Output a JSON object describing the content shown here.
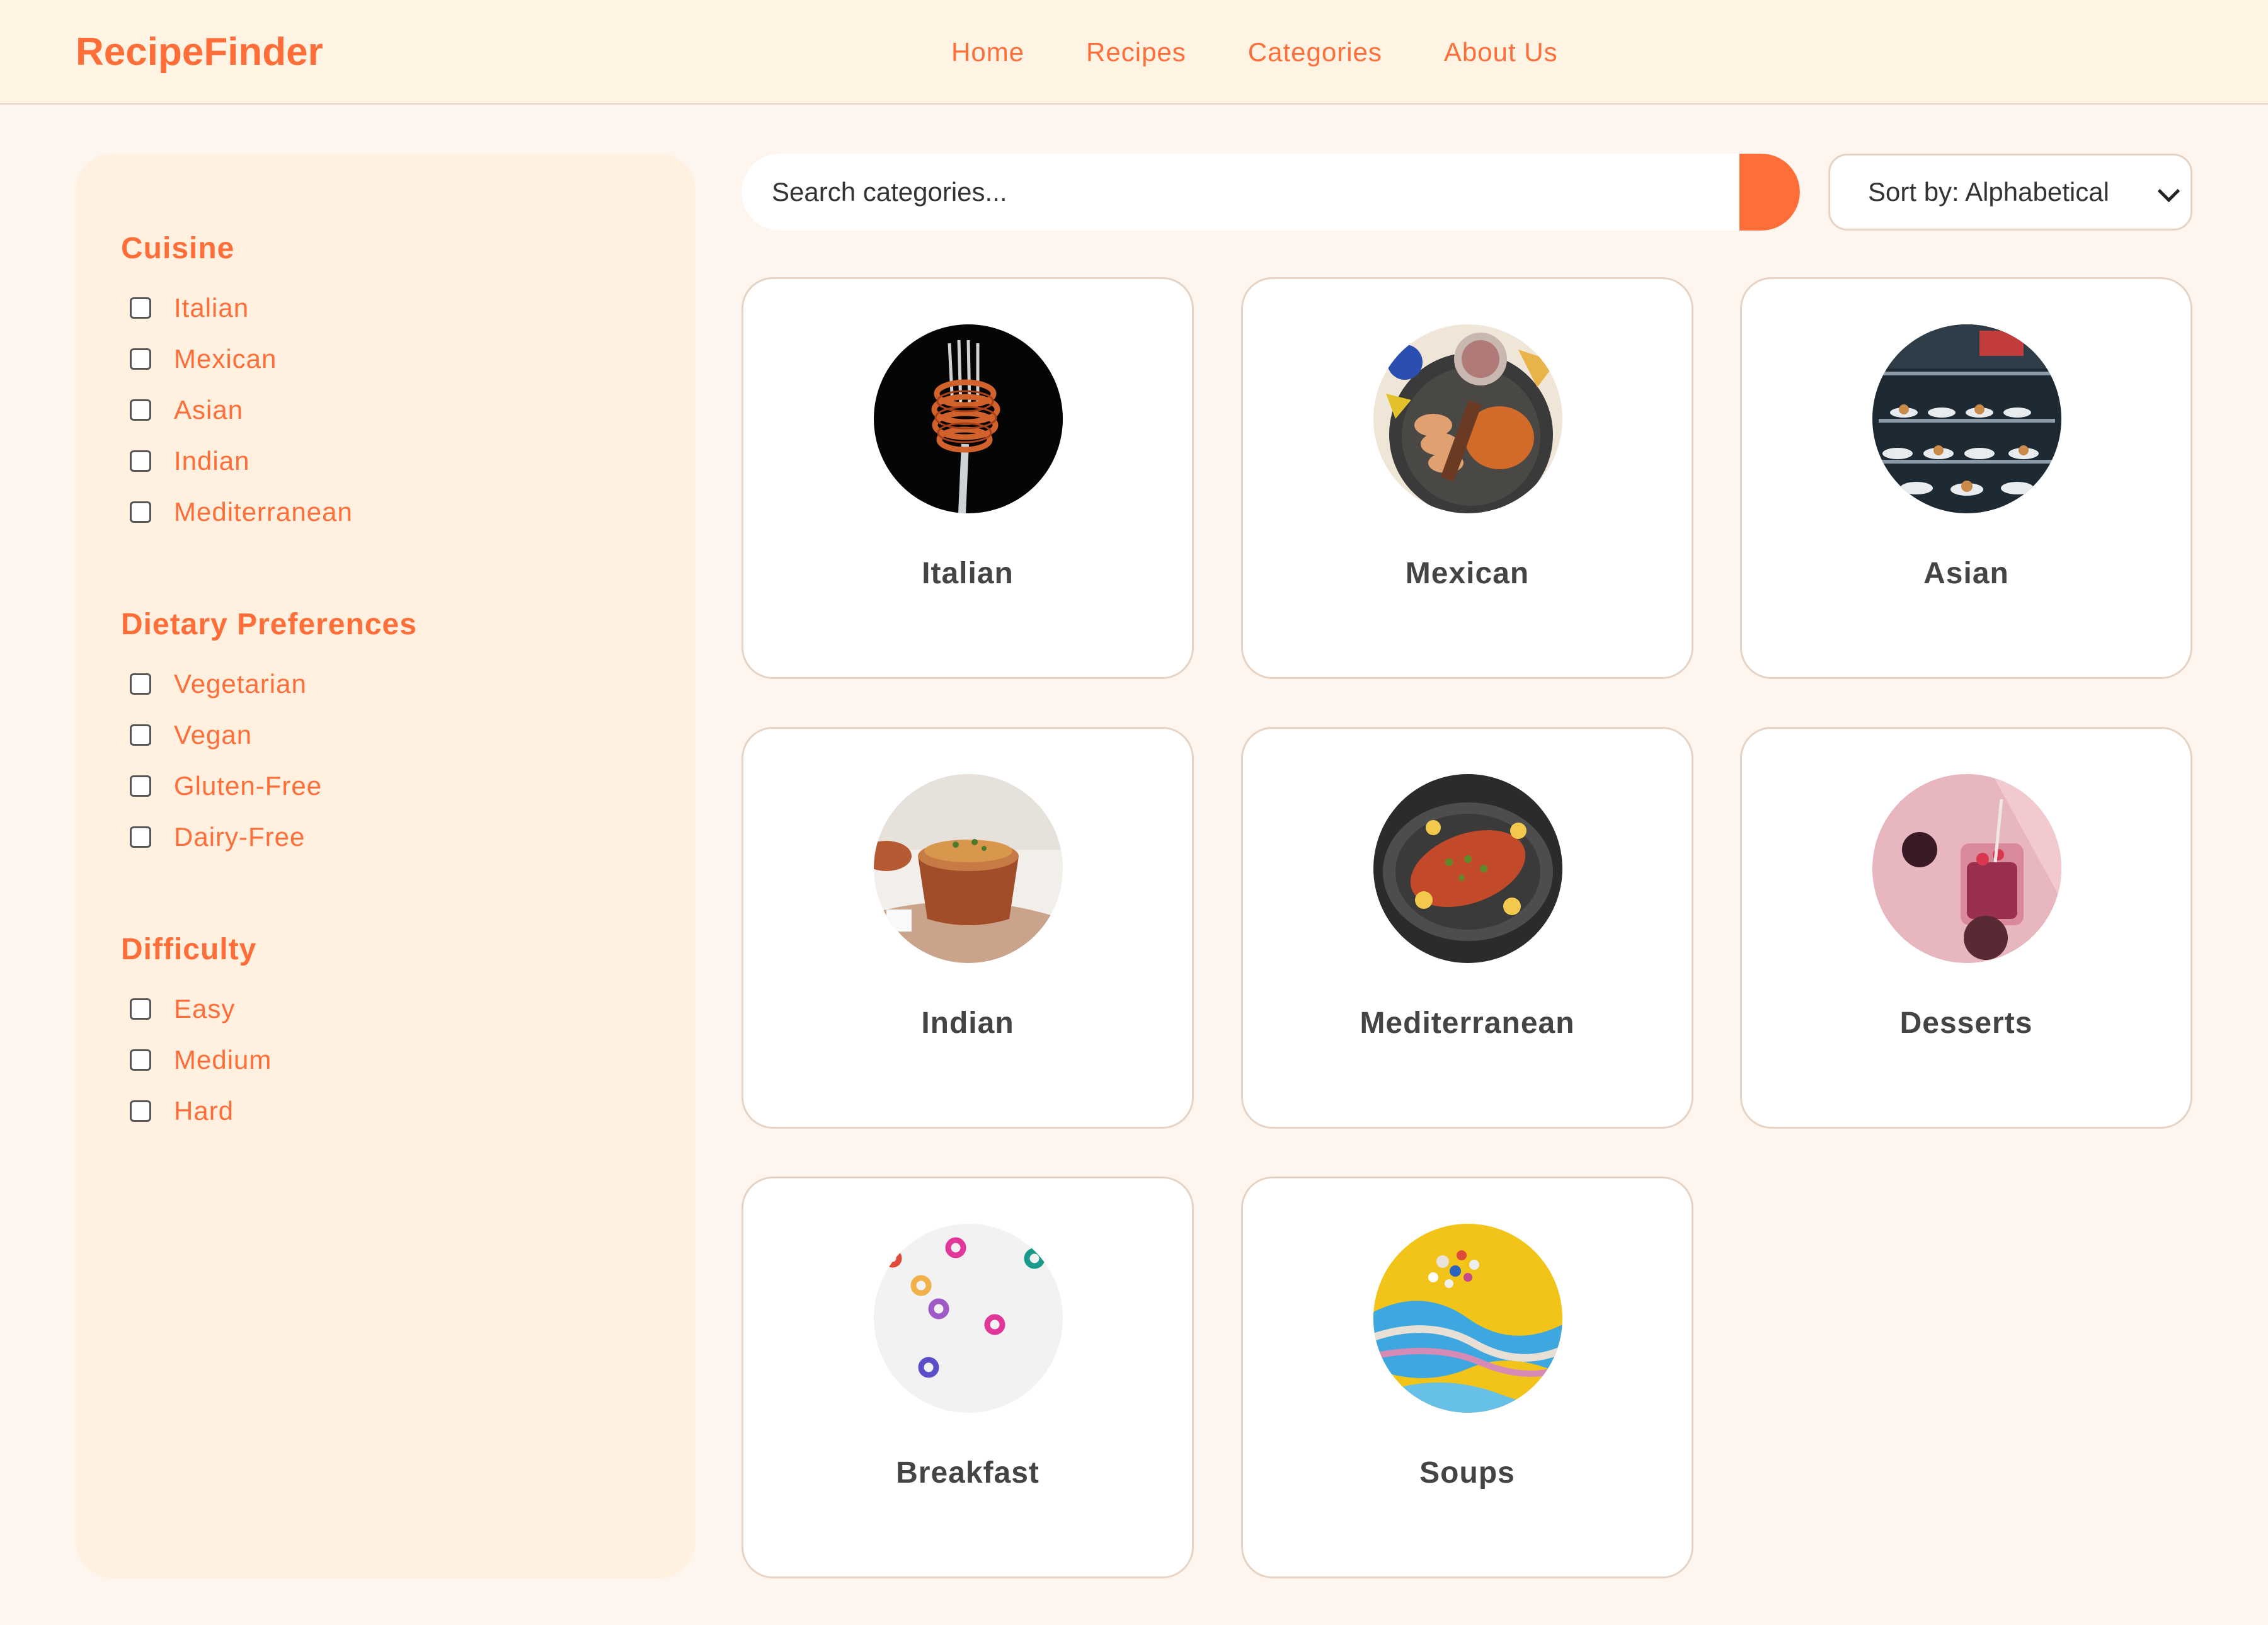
{
  "header": {
    "logo": "RecipeFinder",
    "nav": [
      "Home",
      "Recipes",
      "Categories",
      "About Us"
    ]
  },
  "sidebar": {
    "groups": [
      {
        "title": "Cuisine",
        "options": [
          "Italian",
          "Mexican",
          "Asian",
          "Indian",
          "Mediterranean"
        ]
      },
      {
        "title": "Dietary Preferences",
        "options": [
          "Vegetarian",
          "Vegan",
          "Gluten-Free",
          "Dairy-Free"
        ]
      },
      {
        "title": "Difficulty",
        "options": [
          "Easy",
          "Medium",
          "Hard"
        ]
      }
    ]
  },
  "search": {
    "placeholder": "Search categories..."
  },
  "sort": {
    "selected": "Sort by: Alphabetical"
  },
  "categories": [
    {
      "name": "Italian",
      "image": "spaghetti-fork-photo"
    },
    {
      "name": "Mexican",
      "image": "mexican-platter-photo"
    },
    {
      "name": "Asian",
      "image": "asian-food-display-photo"
    },
    {
      "name": "Indian",
      "image": "biryani-pot-photo"
    },
    {
      "name": "Mediterranean",
      "image": "stuffed-fish-pan-photo"
    },
    {
      "name": "Desserts",
      "image": "pink-drink-photo"
    },
    {
      "name": "Breakfast",
      "image": "cereal-rings-photo"
    },
    {
      "name": "Soups",
      "image": "colorful-swirl-photo"
    }
  ],
  "colors": {
    "accent": "#ff6d38",
    "header_bg": "#fff4e4",
    "sidebar_bg": "#fff0df",
    "page_bg": "#fdf5ee"
  }
}
